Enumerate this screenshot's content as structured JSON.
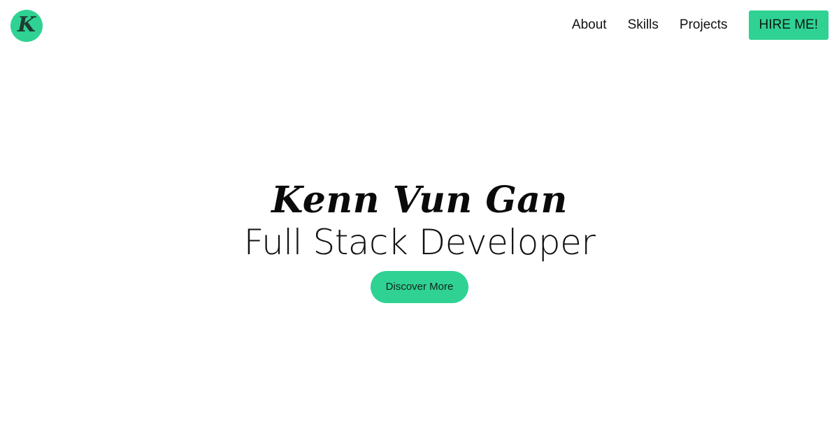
{
  "header": {
    "logo_icon": "k-monogram-logo-icon",
    "logo_letter": "K",
    "nav": {
      "items": [
        {
          "label": "About"
        },
        {
          "label": "Skills"
        },
        {
          "label": "Projects"
        }
      ],
      "cta_label": "HIRE ME!"
    }
  },
  "hero": {
    "name": "Kenn Vun Gan",
    "title": "Full Stack Developer",
    "cta_label": "Discover More"
  },
  "colors": {
    "accent": "#2fd293",
    "text": "#111111",
    "background": "#ffffff"
  }
}
